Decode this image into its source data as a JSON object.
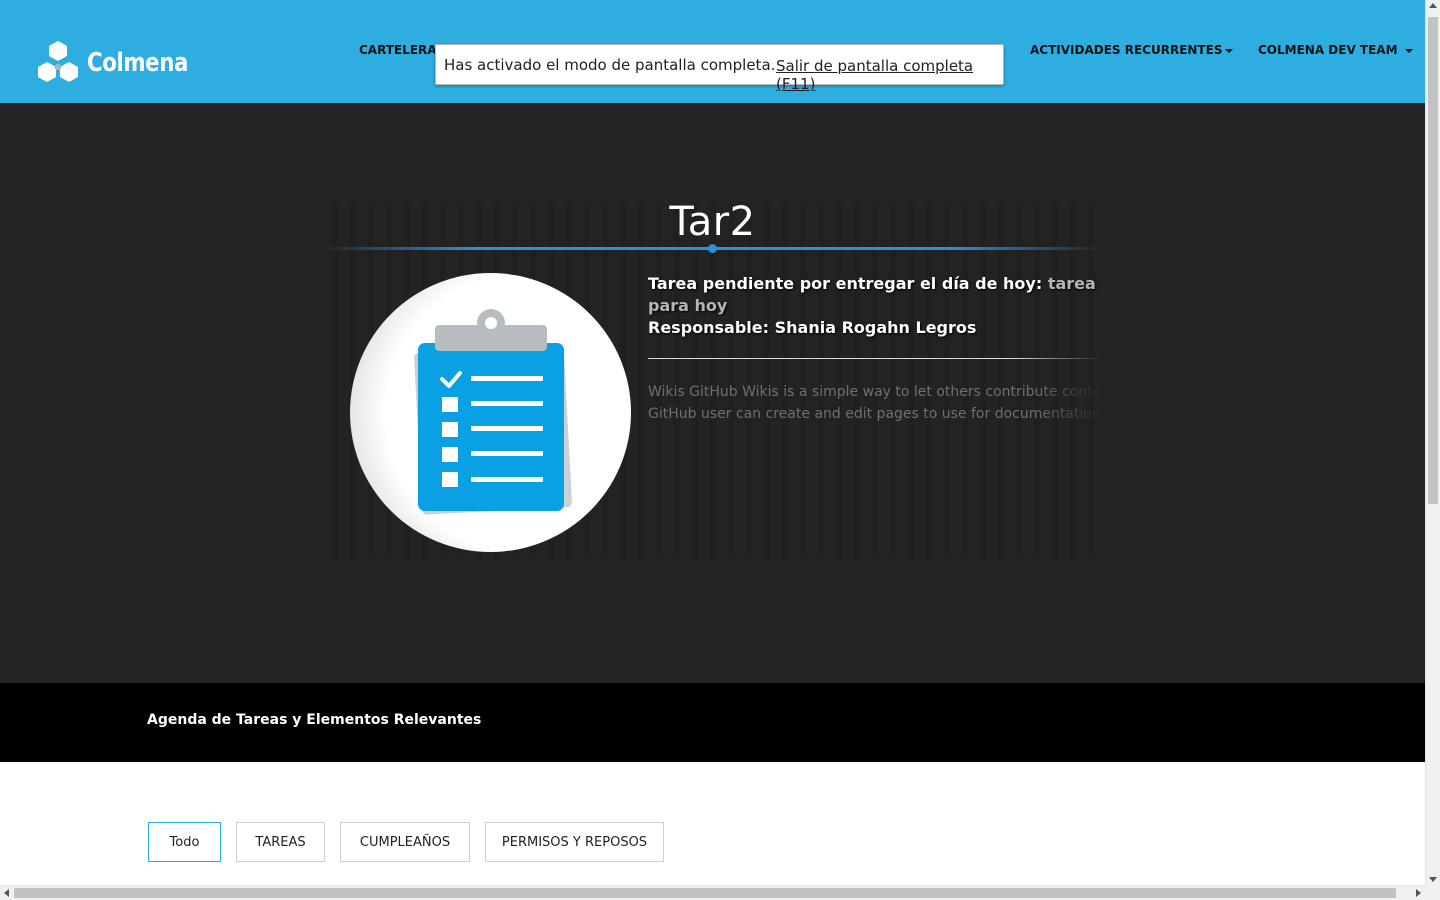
{
  "header": {
    "logo_text": "Colmena",
    "nav": {
      "cartelera": "CARTELERA",
      "actividades": "ACTIVIDADES RECURRENTES",
      "team": "COLMENA DEV TEAM"
    }
  },
  "fullscreen_notice": {
    "message": "Has activado el modo de pantalla completa.",
    "exit_link": "Salir de pantalla completa (F11)"
  },
  "hero": {
    "title": "Tar2",
    "task_label": "Tarea pendiente por entregar el día de hoy:",
    "task_value_1": "tarea",
    "task_value_2": "para hoy",
    "responsible_label": "Responsable:",
    "responsible_name": "Shania Rogahn Legros",
    "description_line1": "Wikis GitHub Wikis is a simple way to let others contribute content. A",
    "description_line2": "GitHub user can create and edit pages to use for documentation.",
    "image_icon": "clipboard-checklist-icon"
  },
  "agenda": {
    "title": "Agenda de Tareas y Elementos Relevantes"
  },
  "filters": {
    "items": [
      "Todo",
      "TAREAS",
      "CUMPLEAÑOS",
      "PERMISOS Y REPOSOS"
    ],
    "active": "Todo"
  },
  "colors": {
    "header_bg": "#2eaee0",
    "hero_bg": "#232323",
    "accent_line": "#2e8fe0",
    "clipboard_blue": "#0aa0e4"
  }
}
